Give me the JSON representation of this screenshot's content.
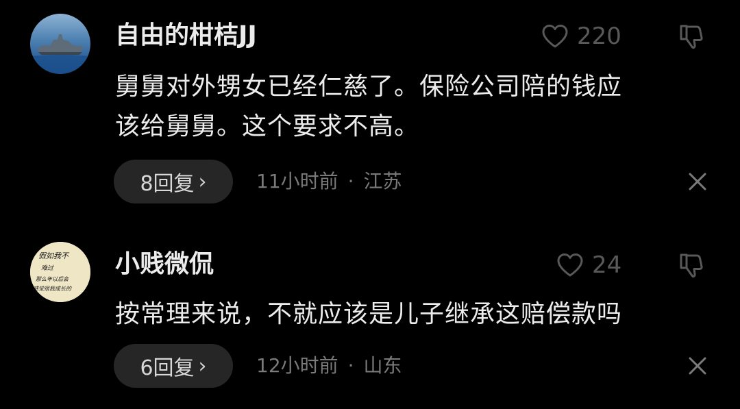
{
  "comments": [
    {
      "username": "自由的柑桔JJ",
      "likes": "220",
      "text_line1": "舅舅对外甥女已经仁慈了。保险公司陪的钱应",
      "text_line2": "该给舅舅。这个要求不高。",
      "reply_label": "8回复",
      "reply_chevron": "›",
      "time": "11小时前",
      "separator": "·",
      "location": "江苏",
      "avatar_icon": "warship-avatar"
    },
    {
      "username": "小贱微侃",
      "likes": "24",
      "text_line1": "按常理来说，不就应该是儿子继承这赔偿款吗",
      "reply_label": "6回复",
      "reply_chevron": "›",
      "time": "12小时前",
      "separator": "·",
      "location": "山东",
      "avatar_icon": "handwriting-avatar",
      "avatar_text": [
        "假如我不",
        "难过",
        "那么年以后会",
        "感觉很我成长的"
      ]
    }
  ],
  "icons": {
    "like": "heart-outline-icon",
    "dislike": "thumbs-down-icon",
    "close": "close-x-icon"
  },
  "colors": {
    "background": "#000000",
    "text": "#ececec",
    "muted": "#7a7a7a",
    "icon": "#595959",
    "pill": "#262626"
  }
}
